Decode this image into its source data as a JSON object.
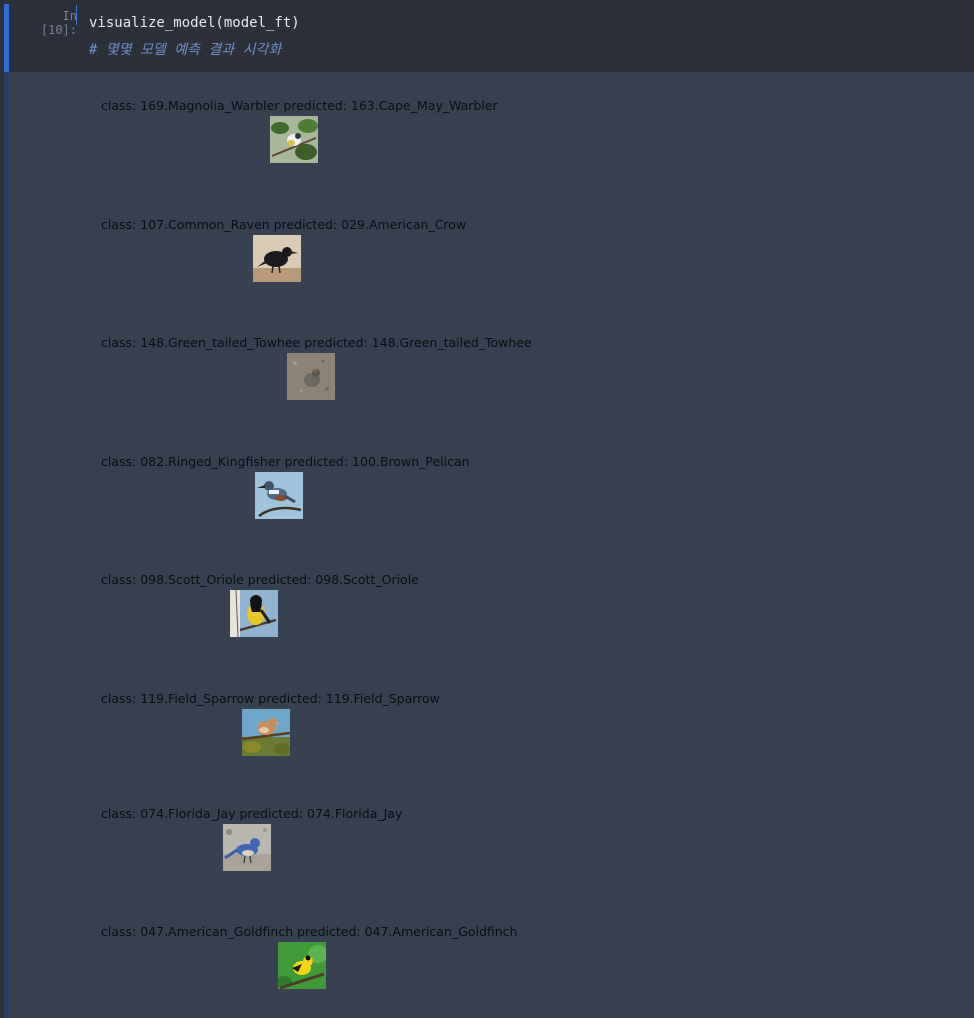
{
  "cell": {
    "prompt": "In [10]:",
    "code": "visualize_model(model_ft)",
    "comment": "# 몇몇 모델 예측 결과 시각화"
  },
  "output": {
    "items": [
      {
        "label": "class: 169.Magnolia_Warbler predicted: 163.Cape_May_Warbler",
        "image": "magnolia-warbler-thumbnail"
      },
      {
        "label": "class: 107.Common_Raven predicted: 029.American_Crow",
        "image": "common-raven-thumbnail"
      },
      {
        "label": "class: 148.Green_tailed_Towhee predicted: 148.Green_tailed_Towhee",
        "image": "green-tailed-towhee-thumbnail"
      },
      {
        "label": "class: 082.Ringed_Kingfisher predicted: 100.Brown_Pelican",
        "image": "ringed-kingfisher-thumbnail"
      },
      {
        "label": "class: 098.Scott_Oriole predicted: 098.Scott_Oriole",
        "image": "scott-oriole-thumbnail"
      },
      {
        "label": "class: 119.Field_Sparrow predicted: 119.Field_Sparrow",
        "image": "field-sparrow-thumbnail"
      },
      {
        "label": "class: 074.Florida_Jay predicted: 074.Florida_Jay",
        "image": "florida-jay-thumbnail"
      },
      {
        "label": "class: 047.American_Goldfinch predicted: 047.American_Goldfinch",
        "image": "american-goldfinch-thumbnail"
      }
    ]
  },
  "colors": {
    "background": "#2b303b",
    "output_background": "#384152",
    "selected_bar": "#2f6fd3",
    "output_bar": "#2a3d63",
    "code_text": "#e6e9ef",
    "comment_text": "#6f8ec7",
    "label_text": "#0b0d12"
  }
}
